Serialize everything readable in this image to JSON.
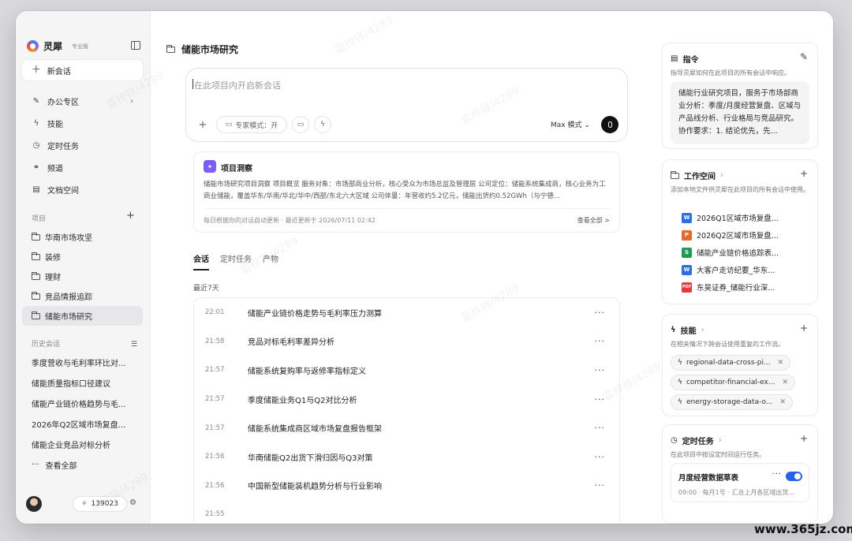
{
  "app": {
    "name": "灵犀",
    "edition": "专业版",
    "new_chat": "新会话"
  },
  "sidebar": {
    "nav": [
      {
        "label": "办公专区",
        "icon": "pen-icon"
      },
      {
        "label": "技能",
        "icon": "lightning-icon"
      },
      {
        "label": "定时任务",
        "icon": "clock-icon"
      },
      {
        "label": "频道",
        "icon": "link-icon"
      },
      {
        "label": "文档空间",
        "icon": "document-icon"
      }
    ],
    "projects_title": "项目",
    "projects": [
      "华南市场攻坚",
      "装修",
      "理财",
      "竞品情报追踪",
      "储能市场研究"
    ],
    "history_title": "历史会话",
    "history": [
      "季度营收与毛利率环比对...",
      "储能质量指标口径建议",
      "储能产业链价格趋势与毛...",
      "2026年Q2区域市场复盘...",
      "储能企业竞品对标分析"
    ],
    "view_all": "查看全部",
    "credits": "139023"
  },
  "main": {
    "title": "储能市场研究",
    "composer": {
      "placeholder": "在此项目内开启新会话",
      "expert_mode": "专家模式：开",
      "model": "Max 模式"
    },
    "insight": {
      "title": "项目洞察",
      "body": "储能市场研究项目洞察 项目概览 服务对象：市场部商业分析，核心受众为市场总监及管理层 公司定位：储能系统集成商，核心业务为工商业储能，覆盖华东/华南/华北/华中/西部/东北六大区域 公司体量：年营收约5.2亿元，储能出货约0.52GWh（与宁德...",
      "footer": "每日根据你的对话自动更新 · 最近更新于 2026/07/11 02:42",
      "view_all": "查看全部 >"
    },
    "tabs": [
      "会话",
      "定时任务",
      "产物"
    ],
    "recent_label": "最近7天",
    "conversations": [
      {
        "time": "22:01",
        "title": "储能产业链价格走势与毛利率压力测算"
      },
      {
        "time": "21:58",
        "title": "竞品对标毛利率差异分析"
      },
      {
        "time": "21:57",
        "title": "储能系统复购率与返修率指标定义"
      },
      {
        "time": "21:57",
        "title": "季度储能业务Q1与Q2对比分析"
      },
      {
        "time": "21:57",
        "title": "储能系统集成商区域市场复盘报告框架"
      },
      {
        "time": "21:56",
        "title": "华南储能Q2出货下滑归因与Q3对策"
      },
      {
        "time": "21:56",
        "title": "中国新型储能装机趋势分析与行业影响"
      },
      {
        "time": "21:55",
        "title": ""
      }
    ]
  },
  "right": {
    "instructions": {
      "title": "指令",
      "desc": "指导灵犀如何在此项目的所有会话中响应。",
      "content": "储能行业研究项目，服务于市场部商业分析：季度/月度经营复盘、区域与产品线分析、行业格局与竞品研究。协作要求：1. 结论优先，先..."
    },
    "workspace": {
      "title": "工作空间",
      "desc": "添加本地文件供灵犀在此项目的所有会话中使用。",
      "files": [
        {
          "name": "2026Q1区域市场复盘...",
          "type": "W",
          "color": "#2b6ee6"
        },
        {
          "name": "2026Q2区域市场复盘...",
          "type": "P",
          "color": "#e8672a"
        },
        {
          "name": "储能产业链价格追踪表...",
          "type": "S",
          "color": "#1f9d55"
        },
        {
          "name": "大客户走访纪要_华东...",
          "type": "W",
          "color": "#2b6ee6"
        },
        {
          "name": "东吴证券_储能行业深...",
          "type": "PDF",
          "color": "#e23b3b"
        }
      ]
    },
    "skills": {
      "title": "技能",
      "desc": "在相关情况下跨会话使用重复的工作流。",
      "items": [
        "regional-data-cross-pi...",
        "competitor-financial-ex...",
        "energy-storage-data-o..."
      ]
    },
    "tasks": {
      "title": "定时任务",
      "desc": "在此项目中按设定时间运行任务。",
      "card": {
        "title": "月度经营数据草表",
        "meta": "09:00 · 每月1号 · 汇总上月各区域出货...",
        "enabled": true
      }
    }
  },
  "branding": {
    "watermark": "霍梓锋/4289",
    "site": "www.365jz.com"
  }
}
